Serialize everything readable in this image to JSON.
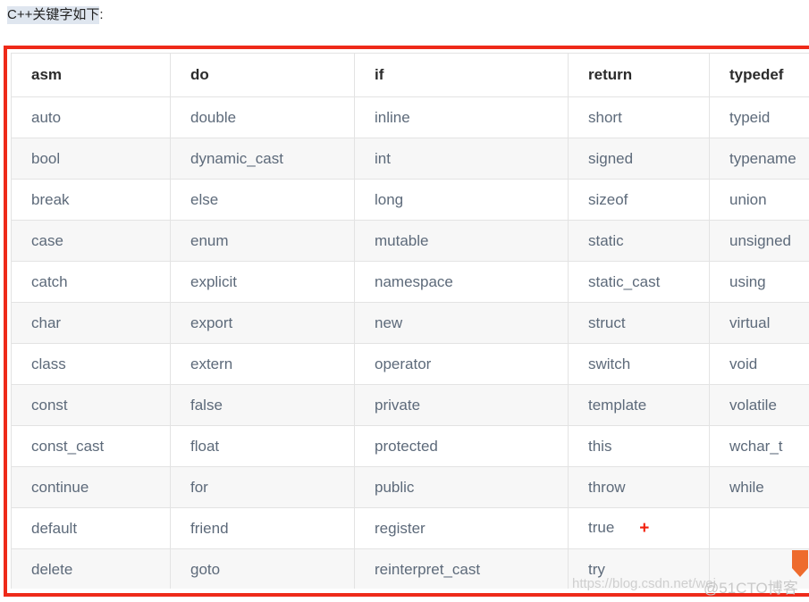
{
  "intro": {
    "highlighted": "C++关键字如下",
    "tail": ":"
  },
  "colors": {
    "frame_red": "#ee2a19",
    "plus_red": "#f21f0c",
    "body_text": "#5d6a7a",
    "header_text": "#2b2b2b",
    "alt_row_bg": "#f7f7f7",
    "grid_line": "#e3e3e3",
    "highlight_bg": "#dfe6ef",
    "watermark": "#cfcfcf",
    "logo_orange": "#ee6b2d"
  },
  "table": {
    "headers": [
      "asm",
      "do",
      "if",
      "return",
      "typedef"
    ],
    "rows": [
      [
        "auto",
        "double",
        "inline",
        "short",
        "typeid"
      ],
      [
        "bool",
        "dynamic_cast",
        "int",
        "signed",
        "typename"
      ],
      [
        "break",
        "else",
        "long",
        "sizeof",
        "union"
      ],
      [
        "case",
        "enum",
        "mutable",
        "static",
        "unsigned"
      ],
      [
        "catch",
        "explicit",
        "namespace",
        "static_cast",
        "using"
      ],
      [
        "char",
        "export",
        "new",
        "struct",
        "virtual"
      ],
      [
        "class",
        "extern",
        "operator",
        "switch",
        "void"
      ],
      [
        "const",
        "false",
        "private",
        "template",
        "volatile"
      ],
      [
        "const_cast",
        "float",
        "protected",
        "this",
        "wchar_t"
      ],
      [
        "continue",
        "for",
        "public",
        "throw",
        "while"
      ],
      [
        "default",
        "friend",
        "register",
        "true",
        ""
      ],
      [
        "delete",
        "goto",
        "reinterpret_cast",
        "try",
        ""
      ]
    ],
    "annotation": {
      "symbol": "+",
      "row_index": 10,
      "col_index": 3
    }
  },
  "watermark": {
    "url": "https://blog.csdn.net/wei",
    "brand": "@51CTO博客"
  }
}
